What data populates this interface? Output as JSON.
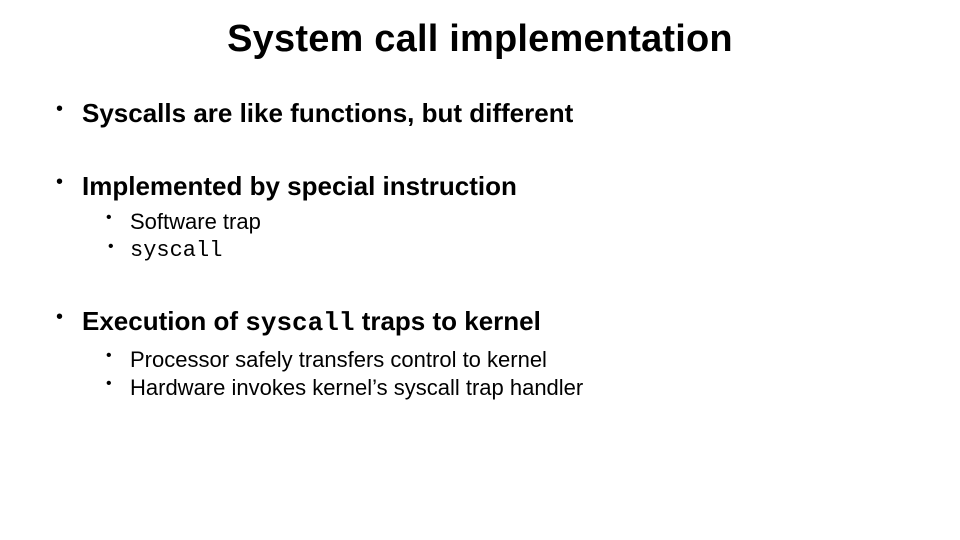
{
  "title": "System call implementation",
  "bullets": {
    "b1": {
      "text": "Syscalls are like functions, but different"
    },
    "b2": {
      "text": "Implemented by special instruction",
      "sub": {
        "s1": "Software trap",
        "s2": "syscall"
      }
    },
    "b3": {
      "prefix": "Execution of ",
      "code": "syscall",
      "suffix": " traps to kernel",
      "sub": {
        "s1": "Processor safely transfers control to kernel",
        "s2": "Hardware invokes kernel’s syscall trap handler"
      }
    }
  }
}
